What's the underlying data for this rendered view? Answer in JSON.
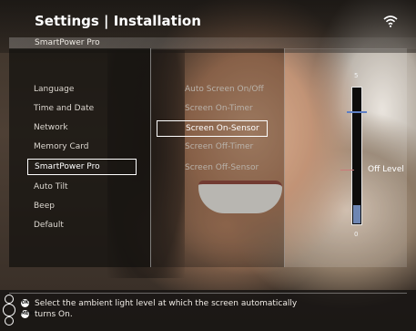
{
  "header": {
    "title": "Settings | Installation",
    "subtitle": "SmartPower Pro"
  },
  "status": {
    "wifi_icon": "wifi-icon"
  },
  "menu": {
    "items": [
      {
        "label": "Language"
      },
      {
        "label": "Time and Date"
      },
      {
        "label": "Network"
      },
      {
        "label": "Memory Card"
      },
      {
        "label": "SmartPower Pro",
        "selected": true
      },
      {
        "label": "Auto Tilt"
      },
      {
        "label": "Beep"
      },
      {
        "label": "Default"
      }
    ]
  },
  "submenu": {
    "items": [
      {
        "label": "Auto Screen On/Off"
      },
      {
        "label": "Screen On-Timer"
      },
      {
        "label": "Screen On-Sensor",
        "selected": true
      },
      {
        "label": "Screen Off-Timer"
      },
      {
        "label": "Screen Off-Sensor"
      }
    ]
  },
  "slider": {
    "max_label": "5",
    "min_label": "0",
    "level_label": "Off Level",
    "fill_fraction": 0.13,
    "marker_fraction": 0.82,
    "level_mark_fraction": 0.4,
    "accent": "#6e86b3"
  },
  "footer": {
    "help_text": "Select the ambient light level at which the screen automatically turns On.",
    "ok_button": "OK",
    "menu_button": "MENU"
  }
}
